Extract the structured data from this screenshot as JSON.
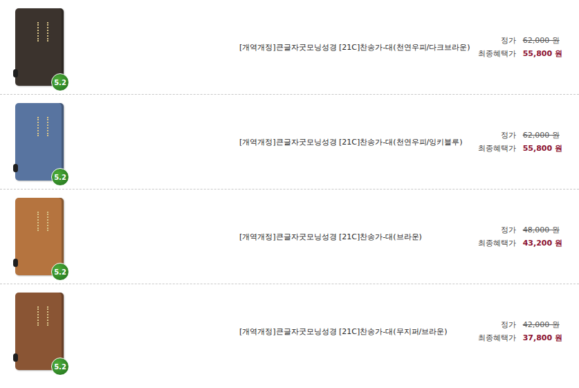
{
  "products": [
    {
      "title": "[개역개정]큰글자굿모닝성경 [21C]찬송가-대(천연우피/다크브라운)",
      "badge": "5.2",
      "list_price_label": "정가",
      "list_price": "62,000 원",
      "final_price_label": "최종혜택가",
      "final_price": "55,800 원",
      "color": "#3b332d"
    },
    {
      "title": "[개역개정]큰글자굿모닝성경 [21C]찬송가-대(천연우피/잉키블루)",
      "badge": "5.2",
      "list_price_label": "정가",
      "list_price": "62,000 원",
      "final_price_label": "최종혜택가",
      "final_price": "55,800 원",
      "color": "#5874a0"
    },
    {
      "title": "[개역개정]큰글자굿모닝성경 [21C]찬송가-대(브라운)",
      "badge": "5.2",
      "list_price_label": "정가",
      "list_price": "48,000 원",
      "final_price_label": "최종혜택가",
      "final_price": "43,200 원",
      "color": "#b5743f"
    },
    {
      "title": "[개역개정]큰글자굿모닝성경 [21C]찬송가-대(무지퍼/브라운)",
      "badge": "5.2",
      "list_price_label": "정가",
      "list_price": "42,000 원",
      "final_price_label": "최종혜택가",
      "final_price": "37,800 원",
      "color": "#8a5534"
    }
  ]
}
